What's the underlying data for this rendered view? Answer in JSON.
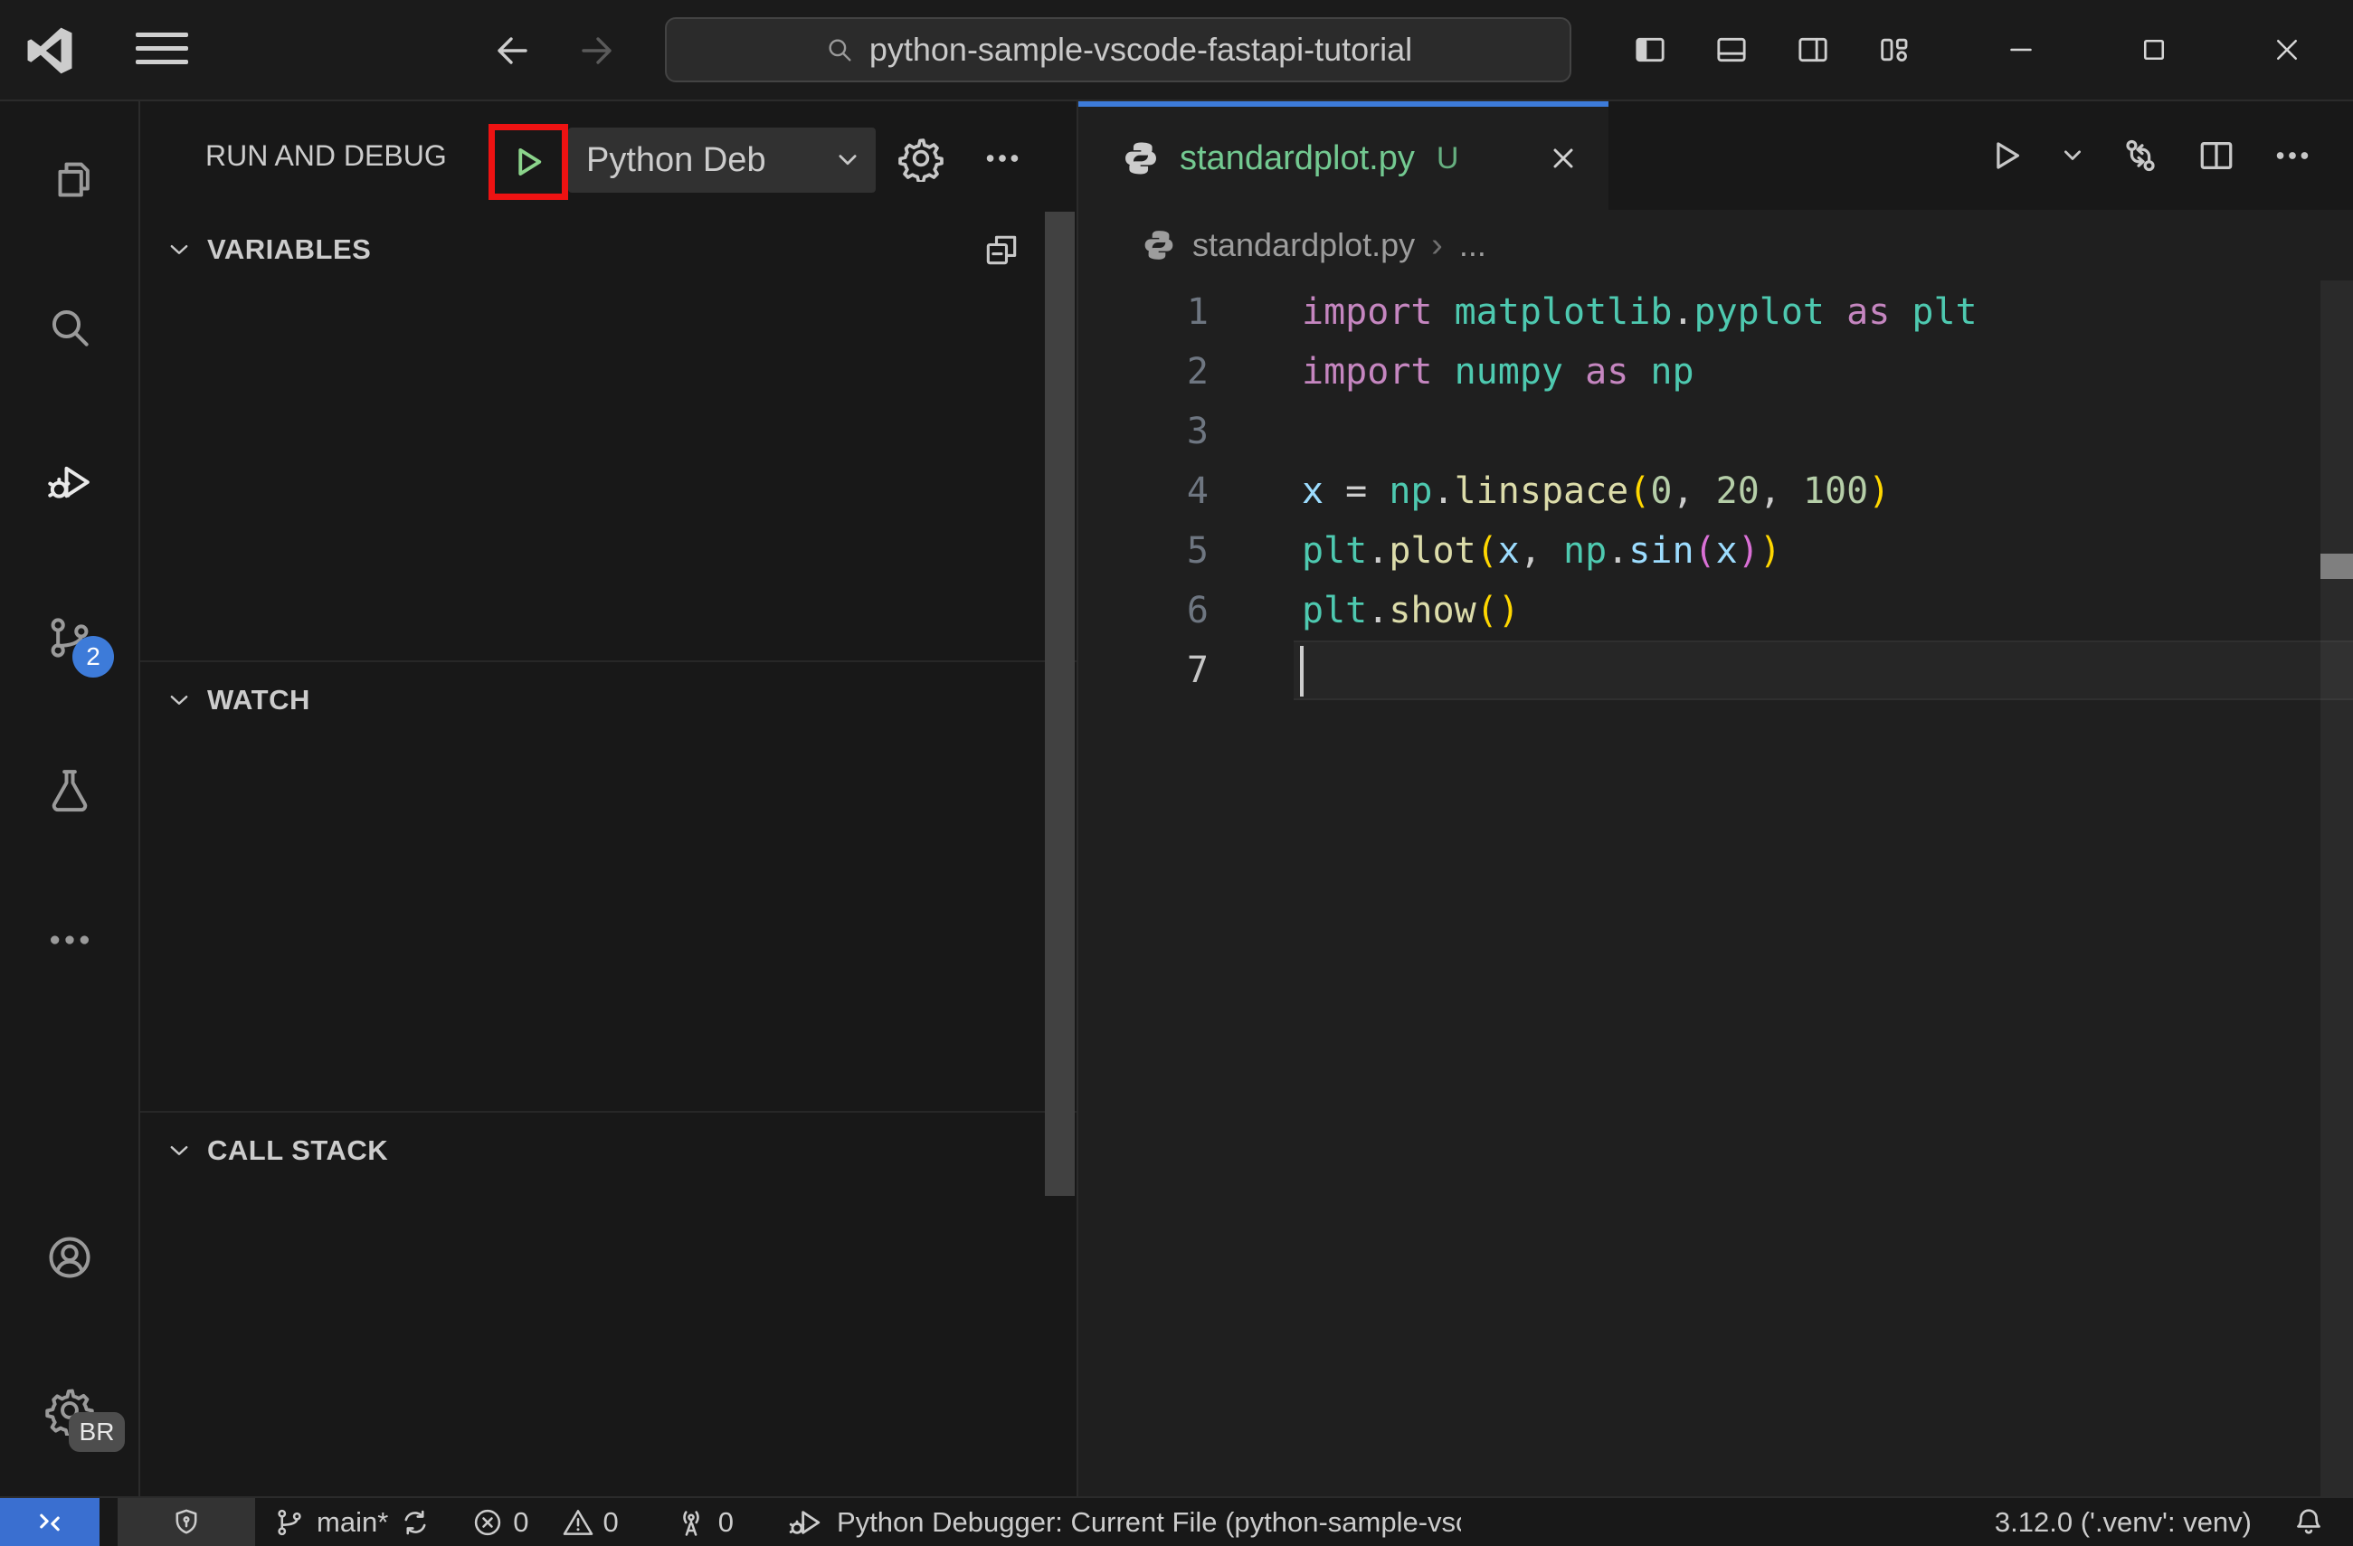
{
  "colors": {
    "accent": "#3d7bd9",
    "remote_blue": "#3a6fd0",
    "play_green": "#8bd48b",
    "annotation_red": "#ee1212",
    "modified_green": "#73c991"
  },
  "title_bar": {
    "search_value": "python-sample-vscode-fastapi-tutorial"
  },
  "activity_bar": {
    "scm_badge": "2",
    "profile_badge": "BR"
  },
  "sidebar": {
    "title": "RUN AND DEBUG",
    "debug_config_label": "Python Deb",
    "sections": {
      "variables": "VARIABLES",
      "watch": "WATCH",
      "call_stack": "CALL STACK"
    }
  },
  "editor": {
    "tab": {
      "label": "standardplot.py",
      "modified": "U"
    },
    "breadcrumb": {
      "file": "standardplot.py",
      "symbol": "..."
    },
    "code": {
      "lines": [
        {
          "num": "1",
          "tokens": [
            [
              "kw",
              "import"
            ],
            [
              "fg",
              " "
            ],
            [
              "mod",
              "matplotlib"
            ],
            [
              "fg",
              "."
            ],
            [
              "mod",
              "pyplot"
            ],
            [
              "fg",
              " "
            ],
            [
              "kw",
              "as"
            ],
            [
              "fg",
              " "
            ],
            [
              "mod",
              "plt"
            ]
          ]
        },
        {
          "num": "2",
          "tokens": [
            [
              "kw",
              "import"
            ],
            [
              "fg",
              " "
            ],
            [
              "mod",
              "numpy"
            ],
            [
              "fg",
              " "
            ],
            [
              "kw",
              "as"
            ],
            [
              "fg",
              " "
            ],
            [
              "mod",
              "np"
            ]
          ]
        },
        {
          "num": "3",
          "tokens": []
        },
        {
          "num": "4",
          "tokens": [
            [
              "var",
              "x"
            ],
            [
              "fg",
              " = "
            ],
            [
              "mod",
              "np"
            ],
            [
              "fg",
              "."
            ],
            [
              "fn",
              "linspace"
            ],
            [
              "b1",
              "("
            ],
            [
              "num",
              "0"
            ],
            [
              "fg",
              ", "
            ],
            [
              "num",
              "20"
            ],
            [
              "fg",
              ", "
            ],
            [
              "num",
              "100"
            ],
            [
              "b1",
              ")"
            ]
          ]
        },
        {
          "num": "5",
          "tokens": [
            [
              "mod",
              "plt"
            ],
            [
              "fg",
              "."
            ],
            [
              "fn",
              "plot"
            ],
            [
              "b1",
              "("
            ],
            [
              "var",
              "x"
            ],
            [
              "fg",
              ", "
            ],
            [
              "mod",
              "np"
            ],
            [
              "fg",
              "."
            ],
            [
              "var",
              "sin"
            ],
            [
              "b2",
              "("
            ],
            [
              "var",
              "x"
            ],
            [
              "b2",
              ")"
            ],
            [
              "b1",
              ")"
            ]
          ]
        },
        {
          "num": "6",
          "tokens": [
            [
              "mod",
              "plt"
            ],
            [
              "fg",
              "."
            ],
            [
              "fn",
              "show"
            ],
            [
              "b1",
              "("
            ],
            [
              "b1",
              ")"
            ]
          ]
        },
        {
          "num": "7",
          "tokens": [],
          "current": true,
          "cursor": true
        }
      ]
    }
  },
  "status_bar": {
    "branch": "main*",
    "errors": "0",
    "warnings": "0",
    "ports": "0",
    "debugger": "Python Debugger: Current File (python-sample-vsco",
    "interpreter": "3.12.0 ('.venv': venv)"
  }
}
